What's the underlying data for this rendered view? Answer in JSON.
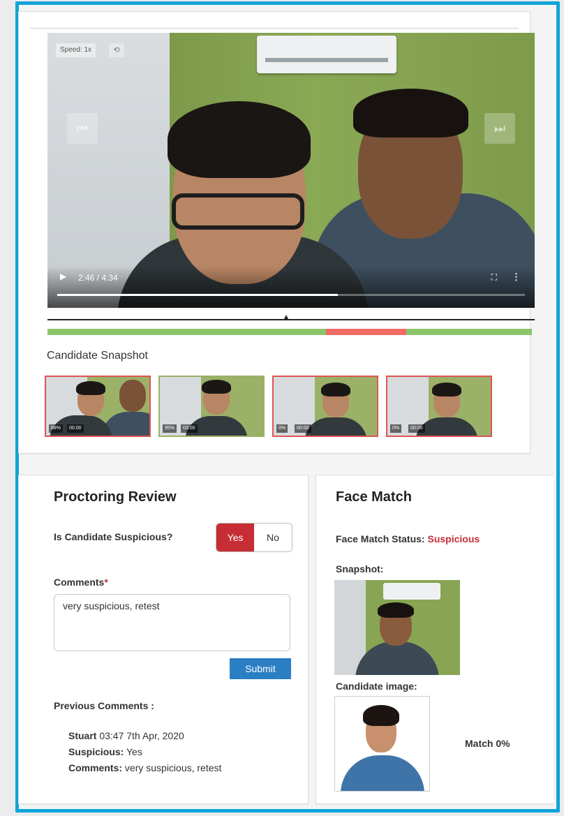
{
  "player": {
    "speed_label": "Speed: 1x",
    "reset_icon": "reset-icon",
    "prev_icon": "skip-back-icon",
    "next_icon": "skip-forward-icon",
    "time": "2:46 / 4:34",
    "progress": 0.6
  },
  "timeline": {
    "marker_fraction": 0.49,
    "segments": [
      {
        "start": 0.0,
        "end": 0.575,
        "color": "#8cc46a"
      },
      {
        "start": 0.575,
        "end": 0.74,
        "color": "#ef6b64"
      },
      {
        "start": 0.74,
        "end": 1.0,
        "color": "#8cc46a"
      }
    ]
  },
  "snapshots": {
    "title": "Candidate Snapshot",
    "items": [
      {
        "score": "88%",
        "time": "00:00",
        "flagged": true
      },
      {
        "score": "95%",
        "time": "03:00",
        "flagged": false
      },
      {
        "score": "0%",
        "time": "00:00",
        "flagged": true
      },
      {
        "score": "0%",
        "time": "00:00",
        "flagged": true
      }
    ]
  },
  "review": {
    "title": "Proctoring Review",
    "question": "Is Candidate Suspicious?",
    "yes_label": "Yes",
    "no_label": "No",
    "comments_label": "Comments",
    "required_mark": "*",
    "comments_value": "very suspicious, retest",
    "submit_label": "Submit",
    "previous_title": "Previous Comments :",
    "previous": {
      "author": "Stuart",
      "datetime": "03:47 7th Apr, 2020",
      "suspicious_label": "Suspicious:",
      "suspicious_value": "Yes",
      "comments_label": "Comments:",
      "comments_value": "very suspicious, retest"
    }
  },
  "face_match": {
    "title": "Face Match",
    "status_label": "Face Match Status:",
    "status_value": "Suspicious",
    "snapshot_label": "Snapshot:",
    "candidate_label": "Candidate image:",
    "match_text": "Match 0%"
  },
  "colors": {
    "frame": "#0ea5d9",
    "danger": "#c62d35",
    "submit": "#2a7ec3"
  }
}
